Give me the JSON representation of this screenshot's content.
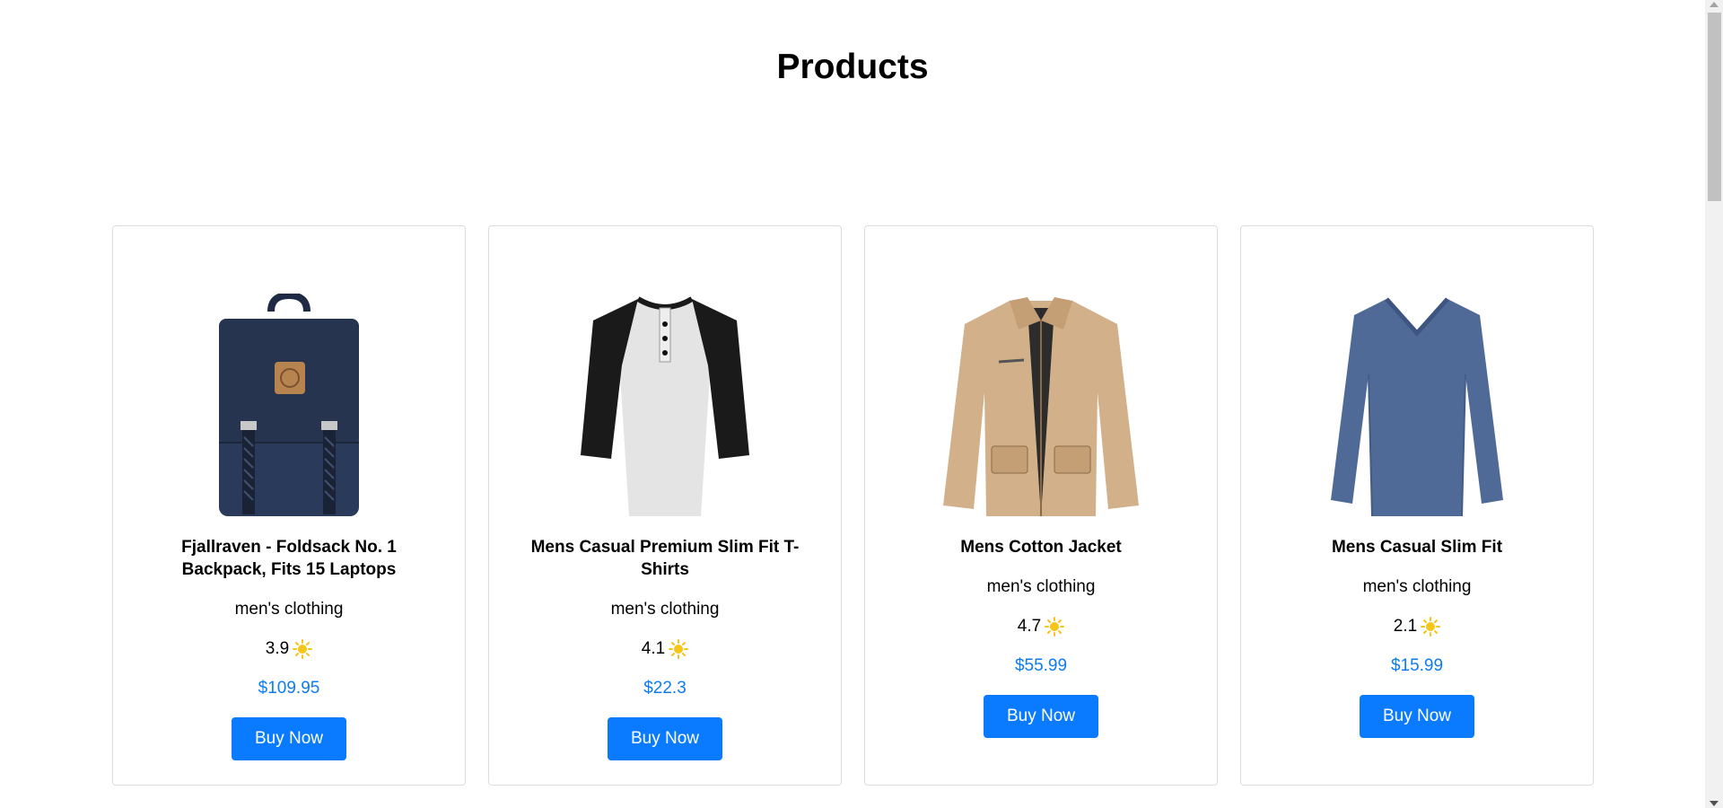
{
  "page": {
    "title": "Products"
  },
  "products": [
    {
      "title": "Fjallraven - Foldsack No. 1 Backpack, Fits 15 Laptops",
      "category": "men's clothing",
      "rating": "3.9",
      "price": "$109.95",
      "button_label": "Buy Now",
      "image_icon": "backpack-icon"
    },
    {
      "title": "Mens Casual Premium Slim Fit T-Shirts",
      "category": "men's clothing",
      "rating": "4.1",
      "price": "$22.3",
      "button_label": "Buy Now",
      "image_icon": "raglan-tshirt-icon"
    },
    {
      "title": "Mens Cotton Jacket",
      "category": "men's clothing",
      "rating": "4.7",
      "price": "$55.99",
      "button_label": "Buy Now",
      "image_icon": "jacket-icon"
    },
    {
      "title": "Mens Casual Slim Fit",
      "category": "men's clothing",
      "rating": "2.1",
      "price": "$15.99",
      "button_label": "Buy Now",
      "image_icon": "long-sleeve-shirt-icon"
    }
  ],
  "colors": {
    "price": "#0d7cf2",
    "button_bg": "#0a7bff",
    "rating_icon": "#f5c518",
    "card_border": "#dcdcdc"
  },
  "rating_icon": "sun-icon"
}
